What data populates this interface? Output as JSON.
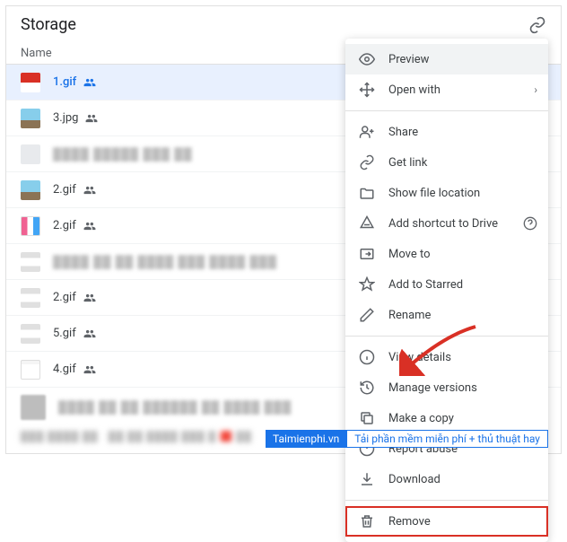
{
  "header": {
    "title": "Storage"
  },
  "columns": {
    "name": "Name"
  },
  "files": [
    {
      "name": "1.gif",
      "selected": true
    },
    {
      "name": "3.jpg"
    },
    {
      "name": ""
    },
    {
      "name": "2.gif"
    },
    {
      "name": "2.gif"
    },
    {
      "name": ""
    },
    {
      "name": "2.gif"
    },
    {
      "name": "5.gif"
    },
    {
      "name": "4.gif"
    },
    {
      "name": ""
    }
  ],
  "menu": {
    "preview": "Preview",
    "openwith": "Open with",
    "share": "Share",
    "getlink": "Get link",
    "showloc": "Show file location",
    "addshortcut": "Add shortcut to Drive",
    "moveto": "Move to",
    "addstarred": "Add to Starred",
    "rename": "Rename",
    "viewdetails": "View details",
    "manageversions": "Manage versions",
    "makecopy": "Make a copy",
    "reportabuse": "Report abuse",
    "download": "Download",
    "remove": "Remove"
  },
  "footer": {
    "brand": "Taimienphi.vn",
    "slogan": "Tải phần mềm miễn phí + thủ thuật hay"
  }
}
